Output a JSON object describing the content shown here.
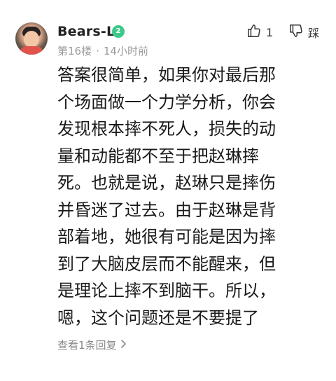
{
  "comment": {
    "username": "Bears-L",
    "level_badge": "2",
    "floor": "第16楼",
    "separator": "·",
    "time_ago": "14小时前",
    "like_count": "1",
    "dislike_label": "踩",
    "body": "答案很简单，如果你对最后那\n个场面做一个力学分析，你会\n发现根本摔不死人，损失的动\n量和动能都不至于把赵琳摔\n死。也就是说，赵琳只是摔伤\n并昏迷了过去。由于赵琳是背\n部着地，她很有可能是因为摔\n到了大脑皮层而不能醒来，但\n是理论上摔不到脑干。所以，\n嗯，这个问题还是不要提了",
    "replies_link": "查看1条回复",
    "colors": {
      "badge": "#3cc98a",
      "meta": "#9a9a9a"
    },
    "icons": [
      "thumbs-up-icon",
      "thumbs-down-icon",
      "chevron-right-icon",
      "level-badge-icon"
    ]
  }
}
